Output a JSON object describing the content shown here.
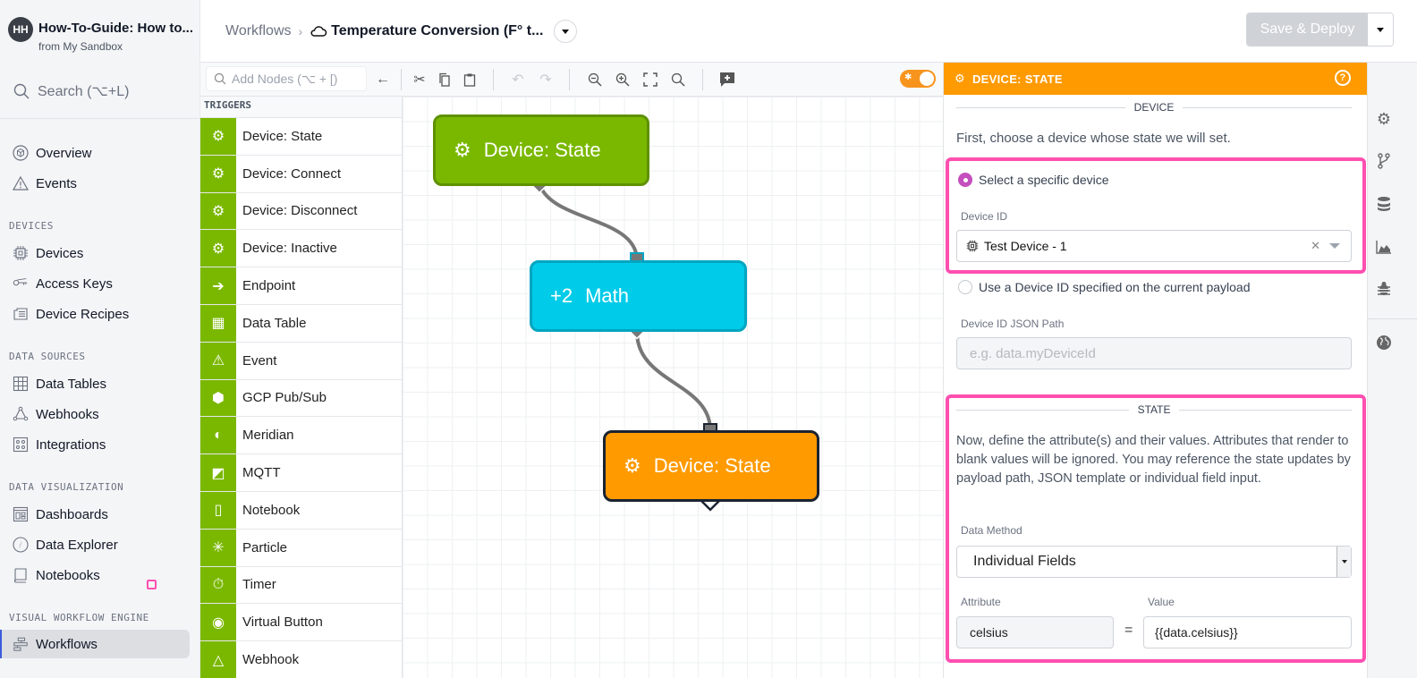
{
  "header": {
    "avatar_initials": "HH",
    "app_title": "How-To-Guide: How to...",
    "app_subtitle": "from My Sandbox",
    "breadcrumb_root": "Workflows",
    "breadcrumb_sep": "›",
    "workflow_name": "Temperature Conversion (F° t...",
    "save_deploy_label": "Save & Deploy"
  },
  "sidebar": {
    "search_placeholder": "Search (⌥+L)",
    "top_items": [
      {
        "label": "Overview",
        "icon": "cube-icon"
      },
      {
        "label": "Events",
        "icon": "warning-icon"
      }
    ],
    "sections": [
      {
        "title": "DEVICES",
        "items": [
          {
            "label": "Devices",
            "icon": "chip-icon"
          },
          {
            "label": "Access Keys",
            "icon": "key-icon"
          },
          {
            "label": "Device Recipes",
            "icon": "recipe-icon"
          }
        ]
      },
      {
        "title": "DATA SOURCES",
        "items": [
          {
            "label": "Data Tables",
            "icon": "table-icon"
          },
          {
            "label": "Webhooks",
            "icon": "webhook-icon"
          },
          {
            "label": "Integrations",
            "icon": "puzzle-icon"
          }
        ]
      },
      {
        "title": "DATA VISUALIZATION",
        "items": [
          {
            "label": "Dashboards",
            "icon": "dashboard-icon"
          },
          {
            "label": "Data Explorer",
            "icon": "compass-icon"
          },
          {
            "label": "Notebooks",
            "icon": "notebook-icon"
          }
        ]
      },
      {
        "title": "VISUAL WORKFLOW ENGINE",
        "items": [
          {
            "label": "Workflows",
            "icon": "workflow-icon",
            "active": true
          }
        ]
      }
    ]
  },
  "toolbar": {
    "add_nodes_placeholder": "Add Nodes (⌥ + [)",
    "debug_enabled": true
  },
  "palette": {
    "header": "TRIGGERS",
    "items": [
      {
        "label": "Device: State",
        "icon": "device-state-icon"
      },
      {
        "label": "Device: Connect",
        "icon": "device-connect-icon"
      },
      {
        "label": "Device: Disconnect",
        "icon": "device-disconnect-icon"
      },
      {
        "label": "Device: Inactive",
        "icon": "device-inactive-icon"
      },
      {
        "label": "Endpoint",
        "icon": "endpoint-icon"
      },
      {
        "label": "Data Table",
        "icon": "data-table-icon"
      },
      {
        "label": "Event",
        "icon": "event-icon"
      },
      {
        "label": "GCP Pub/Sub",
        "icon": "gcp-icon"
      },
      {
        "label": "Meridian",
        "icon": "meridian-icon"
      },
      {
        "label": "MQTT",
        "icon": "mqtt-icon"
      },
      {
        "label": "Notebook",
        "icon": "notebook-icon"
      },
      {
        "label": "Particle",
        "icon": "particle-icon"
      },
      {
        "label": "Timer",
        "icon": "timer-icon"
      },
      {
        "label": "Virtual Button",
        "icon": "virtual-button-icon"
      },
      {
        "label": "Webhook",
        "icon": "webhook-icon"
      }
    ]
  },
  "canvas": {
    "nodes": [
      {
        "label": "Device: State",
        "prefix": "",
        "type": "trigger",
        "color": "#7ab800"
      },
      {
        "label": "Math",
        "prefix": "+2",
        "type": "logic",
        "color": "#00cbe8"
      },
      {
        "label": "Device: State",
        "prefix": "",
        "type": "output",
        "color": "#ff9a00"
      }
    ]
  },
  "panel": {
    "title": "DEVICE: STATE",
    "device_section": "DEVICE",
    "device_intro": "First, choose a device whose state we will set.",
    "radio_specific": "Select a specific device",
    "device_id_label": "Device ID",
    "device_id_value": "Test Device - 1",
    "radio_payload": "Use a Device ID specified on the current payload",
    "json_path_label": "Device ID JSON Path",
    "json_path_placeholder": "e.g. data.myDeviceId",
    "state_section": "STATE",
    "state_intro": "Now, define the attribute(s) and their values. Attributes that render to blank values will be ignored. You may reference the state updates by payload path, JSON template or individual field input.",
    "data_method_label": "Data Method",
    "data_method_value": "Individual Fields",
    "attribute_label": "Attribute",
    "value_label": "Value",
    "attribute_value": "celsius",
    "equals": "=",
    "value_value": "{{data.celsius}}"
  },
  "colors": {
    "trigger_green": "#7ab800",
    "math_cyan": "#00cbe8",
    "output_orange": "#ff9a00",
    "highlight_pink": "#ff4fb0"
  }
}
